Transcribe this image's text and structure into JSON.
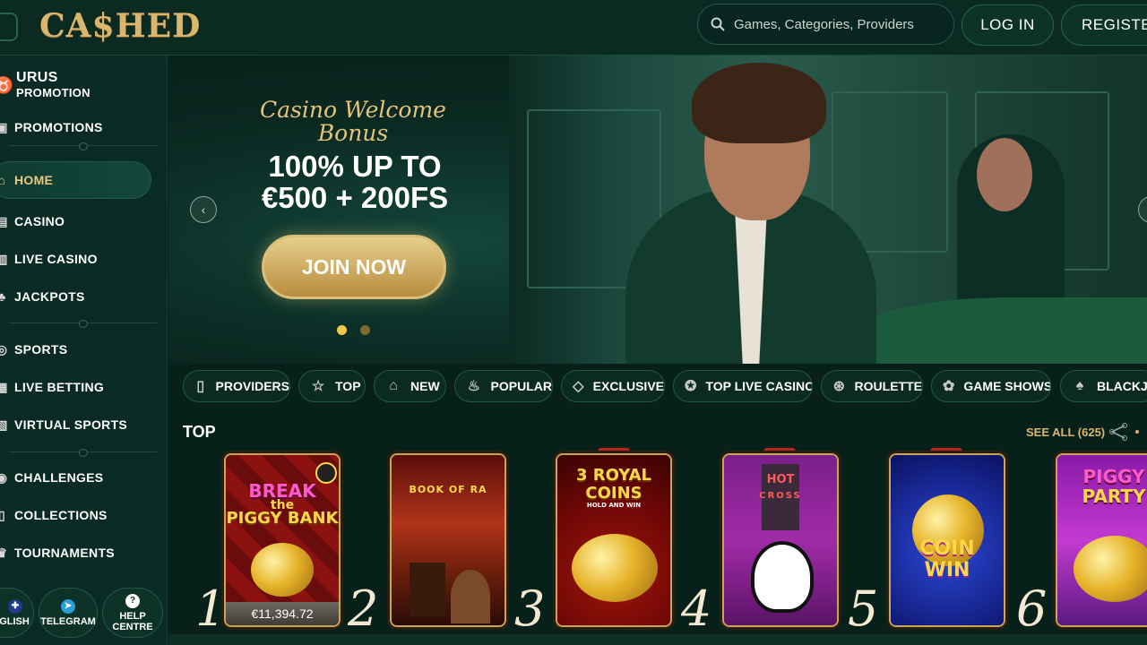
{
  "header": {
    "logo": "CA$HED",
    "search_placeholder": "Games, Categories, Providers",
    "login": "LOG IN",
    "register": "REGISTER"
  },
  "sidebar": {
    "urus_line1": "URUS",
    "urus_line2": "PROMOTION",
    "promotions": "PROMOTIONS",
    "home": "HOME",
    "casino": "CASINO",
    "live_casino": "LIVE CASINO",
    "jackpots": "JACKPOTS",
    "sports": "SPORTS",
    "live_betting": "LIVE BETTING",
    "virtual_sports": "VIRTUAL SPORTS",
    "challenges": "CHALLENGES",
    "collections": "COLLECTIONS",
    "tournaments": "TOURNAMENTS",
    "language": "GLISH",
    "telegram": "TELEGRAM",
    "help_line1": "HELP",
    "help_line2": "CENTRE"
  },
  "hero": {
    "script_title": "Casino Welcome Bonus",
    "headline_line1": "100% UP TO",
    "headline_line2": "€500 + 200FS",
    "cta": "JOIN NOW"
  },
  "categories": [
    "PROVIDERS",
    "TOP",
    "NEW",
    "POPULAR",
    "EXCLUSIVE",
    "TOP LIVE CASINO",
    "ROULETTE",
    "GAME SHOWS",
    "BLACKJA"
  ],
  "top_section": {
    "title": "TOP",
    "see_all": "SEE ALL (625)"
  },
  "games": [
    {
      "rank": "1",
      "title_a": "BREAK",
      "title_b": "the",
      "title_c": "PIGGY BANK",
      "badge": "",
      "jackpot": "€11,394.72"
    },
    {
      "rank": "2",
      "title_a": "BOOK OF RA",
      "badge": ""
    },
    {
      "rank": "3",
      "title_a": "3 ROYAL",
      "title_b": "COINS",
      "title_c": "HOLD AND WIN",
      "badge": "NEW"
    },
    {
      "rank": "4",
      "title_a": "HOT",
      "title_b": "CROSS",
      "badge": "NEW"
    },
    {
      "rank": "5",
      "title_a": "COIN",
      "title_b": "WIN",
      "badge": "NEW"
    },
    {
      "rank": "6",
      "title_a": "PIGGY",
      "title_b": "PARTY",
      "badge": ""
    }
  ],
  "colors": {
    "accent_gold": "#d9b56d",
    "bg": "#07201a",
    "badge_red": "#b3281f"
  }
}
